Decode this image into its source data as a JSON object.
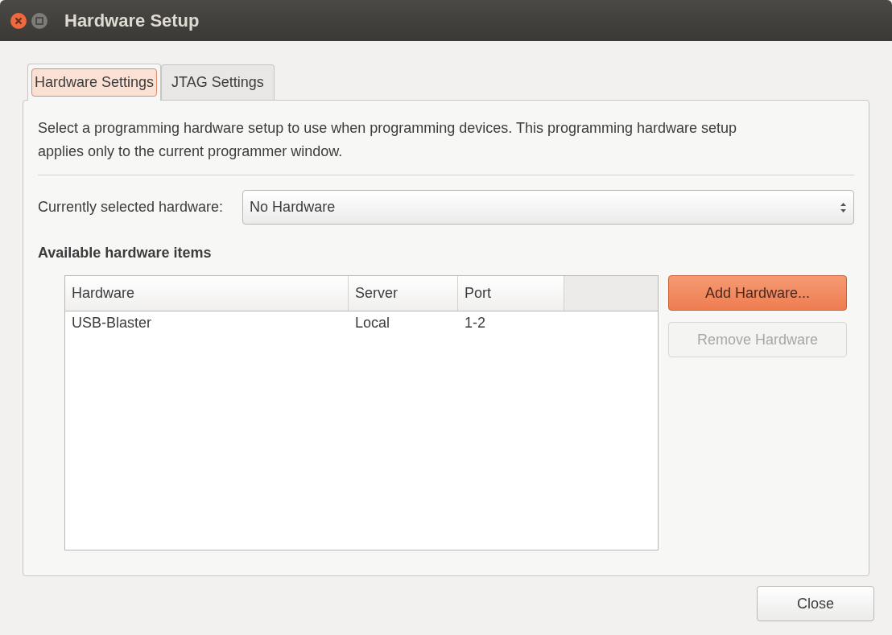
{
  "window": {
    "title": "Hardware Setup"
  },
  "tabs": [
    {
      "label": "Hardware Settings",
      "selected": true
    },
    {
      "label": "JTAG Settings",
      "selected": false
    }
  ],
  "description": "Select a programming hardware setup to use when programming devices. This programming hardware setup applies only to the current programmer window.",
  "hardware_select": {
    "label": "Currently selected hardware:",
    "value": "No Hardware"
  },
  "section_heading": "Available hardware items",
  "table": {
    "columns": [
      "Hardware",
      "Server",
      "Port"
    ],
    "rows": [
      {
        "cells": [
          "USB-Blaster",
          "Local",
          "1-2"
        ],
        "selected": false
      }
    ]
  },
  "side_buttons": [
    {
      "label": "Add Hardware...",
      "disabled": false,
      "default": true
    },
    {
      "label": "Remove Hardware",
      "disabled": true,
      "default": false
    }
  ],
  "footer_button": "Close"
}
